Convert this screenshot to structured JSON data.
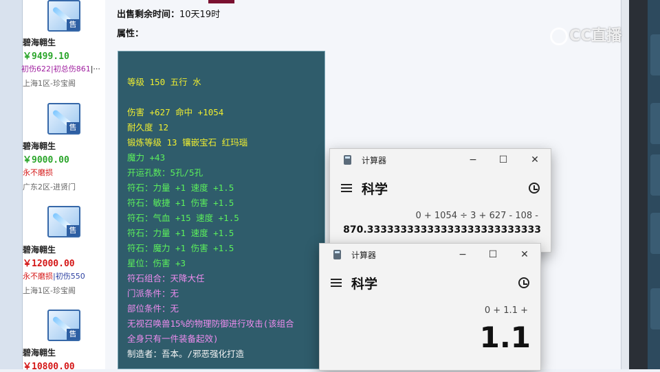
{
  "listing": {
    "items": [
      {
        "name": "碧海翱生",
        "price": "￥9499.10",
        "price_color": "green",
        "attrs": [
          {
            "text": "初伤622",
            "color": "#a020a0"
          },
          {
            "text": "|初总伤861",
            "color": "#a020a0"
          },
          {
            "text": "|···",
            "color": "#222"
          }
        ],
        "server": "上海1区-珍宝阁",
        "sale_badge": "售"
      },
      {
        "name": "碧海翱生",
        "price": "￥9000.00",
        "price_color": "green",
        "attrs": [
          {
            "text": "永不磨损",
            "color": "#d41616"
          }
        ],
        "server": "广东2区-进贤门",
        "sale_badge": "售"
      },
      {
        "name": "碧海翱生",
        "price": "￥12000.00",
        "price_color": "red",
        "attrs": [
          {
            "text": "永不磨损",
            "color": "#d41616"
          },
          {
            "text": "|初伤550",
            "color": "#2b3fa0"
          }
        ],
        "server": "上海1区-珍宝阁",
        "sale_badge": "售"
      },
      {
        "name": "碧海翱生",
        "price": "￥10800.00",
        "price_color": "red",
        "attrs": [],
        "server": "",
        "sale_badge": "售"
      }
    ]
  },
  "detail": {
    "time_label": "出售剩余时间：",
    "time_value": "10天19时",
    "attr_label": "属性：",
    "lines": [
      {
        "text": "等级 150 五行 水",
        "color": "yellow"
      },
      {
        "text": "伤害 +627 命中 +1054",
        "color": "yellow"
      },
      {
        "text": "耐久度 12",
        "color": "yellow"
      },
      {
        "text": "锻炼等级 13 镶嵌宝石 红玛瑙",
        "color": "yellow"
      },
      {
        "text": "魔力 +43",
        "color": "green"
      },
      {
        "text": "开运孔数：5孔/5孔",
        "color": "green"
      },
      {
        "text": "符石：力量 +1 速度 +1.5",
        "color": "green"
      },
      {
        "text": "符石：敏捷 +1 伤害 +1.5",
        "color": "green"
      },
      {
        "text": "符石：气血 +15 速度 +1.5",
        "color": "green"
      },
      {
        "text": "符石：力量 +1 速度 +1.5",
        "color": "green"
      },
      {
        "text": "符石：魔力 +1 伤害 +1.5",
        "color": "green"
      },
      {
        "text": "星位：伤害 +3",
        "color": "green"
      },
      {
        "text": "符石组合：天降大任",
        "color": "pink"
      },
      {
        "text": "门派条件：无",
        "color": "pink"
      },
      {
        "text": "部位条件：无",
        "color": "pink"
      },
      {
        "text": "无视召唤兽15%的物理防御进行攻击(该组合",
        "color": "pink"
      },
      {
        "text": "全身只有一件装备起效)",
        "color": "pink"
      },
      {
        "text": "制造者：吾本。/邪恶强化打造",
        "color": "white"
      }
    ]
  },
  "watermark": {
    "text": "CC直播"
  },
  "calc_back": {
    "title": "计算器",
    "mode": "科学",
    "expression": "0 + 1054 ÷ 3 + 627 - 108 -",
    "result": "870.33333333333333333333333333",
    "minimize": "−",
    "maximize": "☐",
    "close": "✕"
  },
  "calc_front": {
    "title": "计算器",
    "mode": "科学",
    "expression": "0 + 1.1 +",
    "result": "1.1",
    "minimize": "−",
    "maximize": "☐",
    "close": "✕"
  }
}
